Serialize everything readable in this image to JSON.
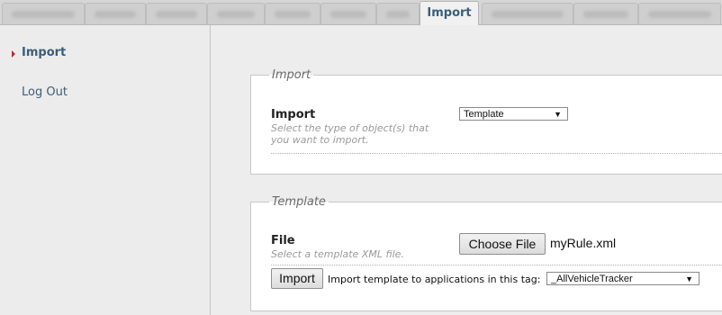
{
  "tabs": {
    "active_label": "Import"
  },
  "sidebar": {
    "items": [
      {
        "label": "Import"
      },
      {
        "label": "Log Out"
      }
    ]
  },
  "import_panel": {
    "legend": "Import",
    "label": "Import",
    "help": "Select the type of object(s) that you want to import.",
    "select_value": "Template"
  },
  "template_panel": {
    "legend": "Template",
    "file_label": "File",
    "file_help": "Select a template XML file.",
    "choose_button": "Choose File",
    "file_name": "myRule.xml",
    "import_button": "Import",
    "tag_prompt": "Import template to applications in this tag:",
    "tag_select_value": "_AllVehicleTracker"
  },
  "icons": {
    "sidebar_active_marker": "triangle-right-icon",
    "select_caret": "caret-down-icon"
  },
  "colors": {
    "link": "#3a5e7c",
    "active_marker": "#d1232a"
  }
}
